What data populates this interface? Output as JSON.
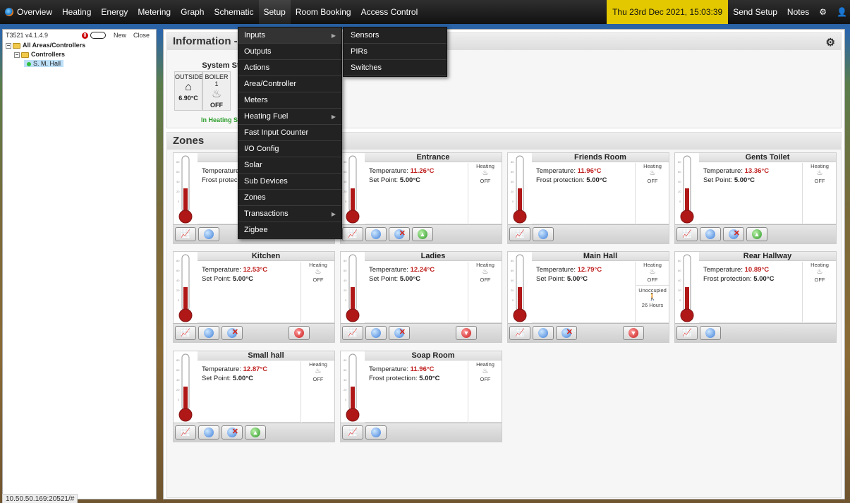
{
  "topbar": {
    "items": [
      "Overview",
      "Heating",
      "Energy",
      "Metering",
      "Graph",
      "Schematic",
      "Setup",
      "Room Booking",
      "Access Control"
    ],
    "datetime": "Thu 23rd Dec 2021, 15:03:39",
    "send_setup": "Send Setup",
    "notes": "Notes",
    "icons": {
      "settings": "gear-icon",
      "user": "user-icon",
      "logo": "app-logo-icon"
    }
  },
  "left": {
    "version": "T3521 v4.1.4.9",
    "alert_count": "0",
    "new_label": "New",
    "close_label": "Close",
    "tree": {
      "root": "All Areas/Controllers",
      "controllers": "Controllers",
      "hall": "S. M. Hall"
    }
  },
  "status_url": "10.50.50.169:20521/#",
  "info": {
    "title": "Information - ",
    "system_status": "System St",
    "outside_label": "OUTSIDE",
    "outside_temp": "6.90°C",
    "boiler_label": "BOILER 1",
    "boiler_state": "OFF",
    "in_heating": "In Heating Se"
  },
  "zones_title": "Zones",
  "labels": {
    "temperature": "Temperature: ",
    "set_point": "Set Point: ",
    "frost": "Frost protection: ",
    "heating": "Heating",
    "off": "OFF",
    "temperature_cut": "Temperature",
    "frost_cut": "Frost protec"
  },
  "zones": [
    {
      "name": "",
      "temp": "",
      "line2_label": "frost",
      "line2_value": "",
      "truncated": true
    },
    {
      "name": "Entrance",
      "temp": "11.26°C",
      "line2_label": "set",
      "line2_value": "5.00°C"
    },
    {
      "name": "Friends Room",
      "temp": "11.96°C",
      "line2_label": "frost",
      "line2_value": "5.00°C"
    },
    {
      "name": "Gents Toilet",
      "temp": "13.36°C",
      "line2_label": "set",
      "line2_value": "5.00°C"
    },
    {
      "name": "Kitchen",
      "temp": "12.53°C",
      "line2_label": "set",
      "line2_value": "5.00°C"
    },
    {
      "name": "Ladies",
      "temp": "12.24°C",
      "line2_label": "set",
      "line2_value": "5.00°C"
    },
    {
      "name": "Main Hall",
      "temp": "12.79°C",
      "line2_label": "set",
      "line2_value": "5.00°C",
      "occupancy": "Unoccupied",
      "hours": "26 Hours"
    },
    {
      "name": "Rear Hallway",
      "temp": "10.89°C",
      "line2_label": "frost",
      "line2_value": "5.00°C"
    },
    {
      "name": "Small hall",
      "temp": "12.87°C",
      "line2_label": "set",
      "line2_value": "5.00°C"
    },
    {
      "name": "Soap Room",
      "temp": "11.96°C",
      "line2_label": "frost",
      "line2_value": "5.00°C"
    }
  ],
  "setup_menu": [
    "Inputs",
    "Outputs",
    "Actions",
    "Area/Controller",
    "Meters",
    "Heating Fuel",
    "Fast Input Counter",
    "I/O Config",
    "Solar",
    "Sub Devices",
    "Zones",
    "Transactions",
    "Zigbee"
  ],
  "inputs_submenu": [
    "Sensors",
    "PIRs",
    "Switches"
  ]
}
